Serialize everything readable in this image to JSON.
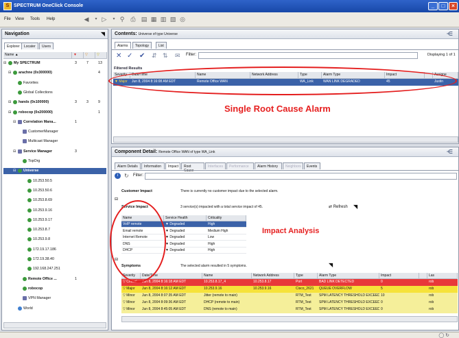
{
  "window": {
    "title": "SPECTRUM OneClick Console"
  },
  "menu": [
    "File",
    "View",
    "Tools",
    "Help"
  ],
  "navigation": {
    "title": "Navigation",
    "tabs": [
      "Explorer",
      "Locater",
      "Users"
    ],
    "columns": [
      "Name"
    ],
    "tree": [
      {
        "label": "My SPECTRUM",
        "indent": 0,
        "c1": "3",
        "c2": "7",
        "c3": "13",
        "bold": true
      },
      {
        "label": "arachne (0x300000)",
        "indent": 1,
        "c1": "",
        "c2": "",
        "c3": "4",
        "bold": true
      },
      {
        "label": "Favorites",
        "indent": 2,
        "c1": "",
        "c2": "",
        "c3": "",
        "bold": false
      },
      {
        "label": "Global Collections",
        "indent": 2,
        "c1": "",
        "c2": "",
        "c3": "",
        "bold": false
      },
      {
        "label": "hands (0x100000)",
        "indent": 1,
        "c1": "3",
        "c2": "3",
        "c3": "9",
        "bold": true
      },
      {
        "label": "robocop (0x200000)",
        "indent": 1,
        "c1": "",
        "c2": "",
        "c3": "1",
        "bold": true
      },
      {
        "label": "Correlation Mana...",
        "indent": 2,
        "c1": "1",
        "c2": "",
        "c3": "",
        "bold": true
      },
      {
        "label": "CustomerManager",
        "indent": 3,
        "c1": "",
        "c2": "",
        "c3": "",
        "bold": false
      },
      {
        "label": "Multicast Manager",
        "indent": 3,
        "c1": "",
        "c2": "",
        "c3": "",
        "bold": false
      },
      {
        "label": "Service Manager",
        "indent": 2,
        "c1": "3",
        "c2": "",
        "c3": "",
        "bold": true
      },
      {
        "label": "TopOrg",
        "indent": 3,
        "c1": "",
        "c2": "",
        "c3": "",
        "bold": false
      },
      {
        "label": "Universe",
        "indent": 2,
        "c1": "",
        "c2": "",
        "c3": "",
        "bold": true,
        "selected": true
      },
      {
        "label": "10.253.50.5",
        "indent": 4,
        "c1": "",
        "c2": "",
        "c3": "",
        "bold": false
      },
      {
        "label": "10.253.50.6",
        "indent": 4,
        "c1": "",
        "c2": "",
        "c3": "",
        "bold": false
      },
      {
        "label": "10.253.8.69",
        "indent": 4,
        "c1": "",
        "c2": "",
        "c3": "",
        "bold": false
      },
      {
        "label": "10.253.9.16",
        "indent": 4,
        "c1": "",
        "c2": "",
        "c3": "",
        "bold": false
      },
      {
        "label": "10.253.9.17",
        "indent": 4,
        "c1": "",
        "c2": "",
        "c3": "",
        "bold": false
      },
      {
        "label": "10.253.8.7",
        "indent": 4,
        "c1": "",
        "c2": "",
        "c3": "",
        "bold": false
      },
      {
        "label": "10.253.9.8",
        "indent": 4,
        "c1": "",
        "c2": "",
        "c3": "",
        "bold": false
      },
      {
        "label": "172.19.17.186",
        "indent": 4,
        "c1": "",
        "c2": "",
        "c3": "",
        "bold": false
      },
      {
        "label": "172.19.38.40",
        "indent": 4,
        "c1": "",
        "c2": "",
        "c3": "",
        "bold": false
      },
      {
        "label": "192.168.247.251",
        "indent": 4,
        "c1": "",
        "c2": "",
        "c3": "",
        "bold": false
      },
      {
        "label": "Remote Office ...",
        "indent": 3,
        "c1": "1",
        "c2": "",
        "c3": "",
        "bold": true
      },
      {
        "label": "robocop",
        "indent": 3,
        "c1": "",
        "c2": "",
        "c3": "",
        "bold": true
      },
      {
        "label": "VPN Manager",
        "indent": 3,
        "c1": "",
        "c2": "",
        "c3": "",
        "bold": false
      },
      {
        "label": "World",
        "indent": 2,
        "c1": "",
        "c2": "",
        "c3": "",
        "bold": false
      }
    ]
  },
  "contents": {
    "title": "Contents:",
    "subtitle": "Universe of type Universe",
    "tabs": [
      "Alarms",
      "Topology",
      "List"
    ],
    "filter_label": "Filter:",
    "displaying": "Displaying 1 of 1",
    "filtered_label": "Filtered Results",
    "columns": [
      "Severity",
      "Date/Time",
      "Name",
      "Network Address",
      "Type",
      "Alarm Type",
      "Impact",
      "",
      "Assigne"
    ],
    "rows": [
      [
        "Major",
        "Jun 8, 2004 8:16:08 AM EDT",
        "Remote Office WAN",
        "",
        "WA_Link",
        "WAN LINK DEGRADED",
        "45",
        "",
        "Justin"
      ]
    ]
  },
  "callouts": {
    "root_cause": "Single Root Cause Alarm",
    "impact": "Impact Analysis"
  },
  "detail": {
    "title": "Component Detail:",
    "subtitle": "Remote Office WAN of type WA_Link",
    "tabs": [
      "Alarm Details",
      "Information",
      "Impact",
      "Root Cause",
      "Interfaces",
      "Performance",
      "Alarm History",
      "Neighbors",
      "Events"
    ],
    "filter_label": "Filter:",
    "customer_impact_label": "Customer Impact",
    "customer_impact_text": "There is currently no customer impact due to the selected alarm.",
    "service_impact_label": "Service Impact",
    "service_impact_text": "3 service(s) impacted with a total service impact of 45.",
    "refresh_label": "Refresh",
    "service_columns": [
      "Name",
      "Service Health",
      "Criticality"
    ],
    "services": [
      [
        "VoIP remote",
        "Degraded",
        "High"
      ],
      [
        "Email remote",
        "Degraded",
        "Medium High"
      ],
      [
        "Internet Remote",
        "Degraded",
        "Low"
      ],
      [
        "DNS",
        "Degraded",
        "High"
      ],
      [
        "DHCP",
        "Degraded",
        "High"
      ]
    ],
    "symptoms_label": "Symptoms",
    "symptoms_text": "The selected alarm resulted in 5 symptoms.",
    "symptom_columns": [
      "Severity",
      "Date/Time",
      "Name",
      "Network Address",
      "Type",
      "Alarm Type",
      "Impact",
      "",
      "Las"
    ],
    "symptoms": [
      [
        "Critical",
        "Jun 8, 2004 8:16:18 AM EDT",
        "10.253.8.17_4",
        "10.253.8.17",
        "Port",
        "BAD LINK DETECTED",
        "0",
        "",
        "rob"
      ],
      [
        "Major",
        "Jun 8, 2004 8:16:12 AM EDT",
        "10.253.9.16",
        "10.253.9.16",
        "Cisco_2621",
        "QUEUE OVERFLOW",
        "5",
        "",
        "rob"
      ],
      [
        "Minor",
        "Jun 8, 2004 8:07:35 AM EDT",
        "Jitter (remote to main)",
        "",
        "RTM_Test",
        "SPM LATENCY THRESHOLD EXCEEDED",
        "10",
        "",
        "rob"
      ],
      [
        "Minor",
        "Jun 8, 2004 8:09:36 AM EDT",
        "DHCP (remote to main)",
        "",
        "RTM_Test",
        "SPM LATENCY THRESHOLD EXCEEDED",
        "0",
        "",
        "rob"
      ],
      [
        "Minor",
        "Jun 8, 2004 8:45:05 AM EDT",
        "DNS (remote to main)",
        "",
        "RTM_Test",
        "SPM LATENCY THRESHOLD EXCEEDED",
        "0",
        "",
        "rob"
      ]
    ]
  },
  "colors": {
    "critical": "#e8383a",
    "major": "#f6e23a",
    "minor": "#f5ef9a",
    "selected_row": "#3b62a8",
    "callout": "#e41e1e"
  }
}
